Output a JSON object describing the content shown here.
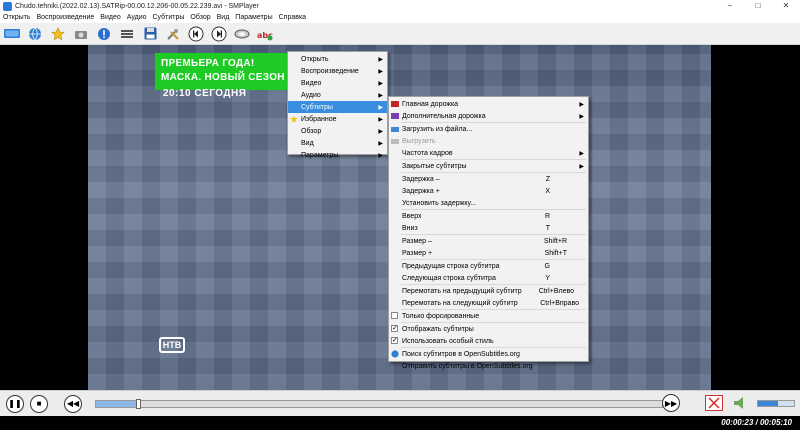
{
  "window": {
    "title": "Chudo.tehniki.(2022.02.13).SATRip-00.00.12.206-00.05.22.239.avi - SMPlayer",
    "controls": [
      "–",
      "□",
      "✕"
    ]
  },
  "menubar": [
    "Открыть",
    "Воспроизведение",
    "Видео",
    "Аудио",
    "Субтитры",
    "Обзор",
    "Вид",
    "Параметры",
    "Справка"
  ],
  "video": {
    "promo_line1": "ПРЕМЬЕРА ГОДА!",
    "promo_line2": "МАСКА. НОВЫЙ СЕЗОН",
    "promo_time": "20:10 СЕГОДНЯ",
    "logo": "НТВ"
  },
  "main_menu": [
    {
      "label": "Открыть"
    },
    {
      "label": "Воспроизведение"
    },
    {
      "label": "Видео"
    },
    {
      "label": "Аудио"
    },
    {
      "label": "Субтитры"
    },
    {
      "label": "Избранное"
    },
    {
      "label": "Обзор"
    },
    {
      "label": "Вид"
    },
    {
      "label": "Параметры"
    }
  ],
  "subtitles_menu": {
    "primary_track": "Главная дорожка",
    "secondary_track": "Дополнительная дорожка",
    "load_file": "Загрузить из файла...",
    "unload": "Выгрузить",
    "framerate": "Частота кадров",
    "closed_captions": "Закрытые субтитры",
    "delay_minus": "Задержка –",
    "delay_minus_sc": "Z",
    "delay_plus": "Задержка +",
    "delay_plus_sc": "X",
    "set_delay": "Установить задержку...",
    "up": "Вверх",
    "up_sc": "R",
    "down": "Вниз",
    "down_sc": "T",
    "size_minus": "Размер –",
    "size_minus_sc": "Shift+R",
    "size_plus": "Размер +",
    "size_plus_sc": "Shift+T",
    "prev_line": "Предыдущая строка субтитра",
    "prev_line_sc": "G",
    "next_line": "Следующая строка субтитра",
    "next_line_sc": "Y",
    "seek_prev": "Перемотать на предыдущий субтитр",
    "seek_prev_sc": "Ctrl+Влево",
    "seek_next": "Перемотать на следующий субтитр",
    "seek_next_sc": "Ctrl+Вправо",
    "forced_only": "Только форсированные",
    "show_subs": "Отображать субтитры",
    "custom_style": "Использовать особый стиль",
    "find_opensubs": "Поиск субтитров в OpenSubtitles.org",
    "upload_opensubs": "Отправить субтитры в OpenSubtitles.org"
  },
  "playback": {
    "progress": 0.075,
    "volume": 0.55,
    "time": "00:00:23 / 00:05:10"
  },
  "colors": {
    "menu_highlight": "#3a8ee0",
    "promo_green": "#1ecb25"
  }
}
